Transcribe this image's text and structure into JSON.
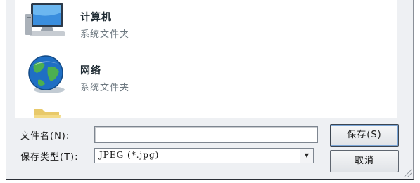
{
  "places": [
    {
      "title": "计算机",
      "subtitle": "系统文件夹",
      "icon": "computer-icon"
    },
    {
      "title": "网络",
      "subtitle": "系统文件夹",
      "icon": "network-globe-icon"
    },
    {
      "icon": "folder-icon"
    }
  ],
  "scrollbar": {
    "up_arrow": "▲",
    "down_arrow": "▼"
  },
  "form": {
    "filename_label": "文件名(N):",
    "filename_value": "",
    "filetype_label": "保存类型(T):",
    "filetype_value": "JPEG (*.jpg)",
    "dropdown_arrow": "▼"
  },
  "buttons": {
    "save": "保存(S)",
    "cancel": "取消"
  }
}
